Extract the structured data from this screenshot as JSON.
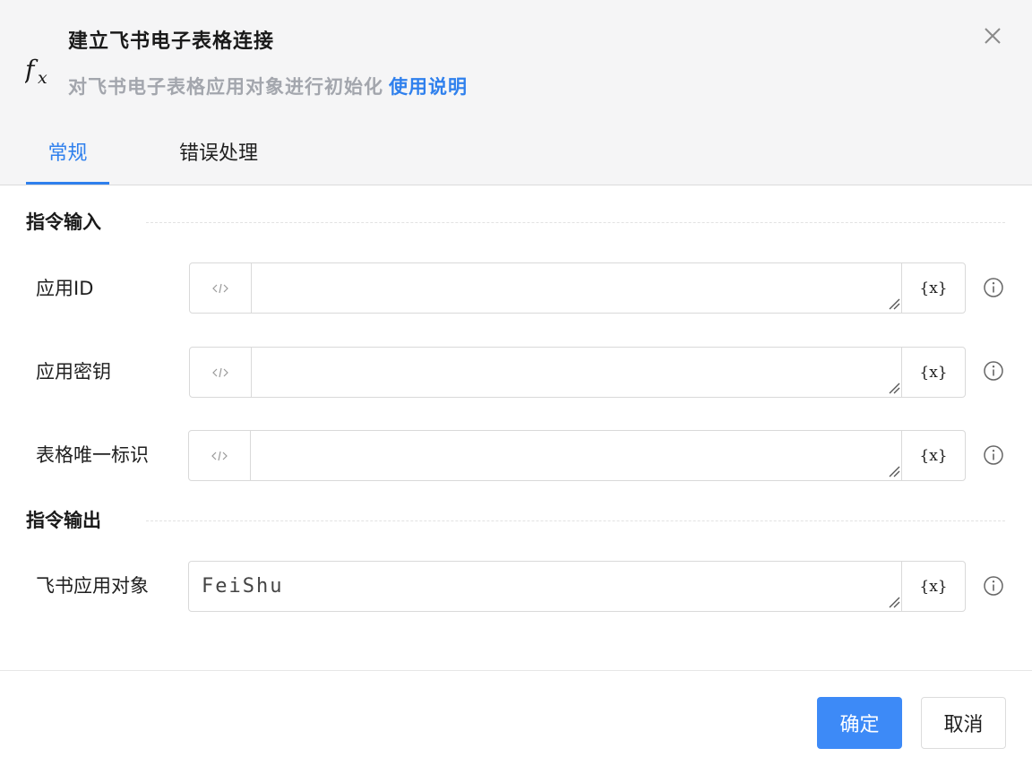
{
  "dialog": {
    "title": "建立飞书电子表格连接",
    "subtitle": "对飞书电子表格应用对象进行初始化",
    "help_link": "使用说明",
    "icon": "fx-icon"
  },
  "tabs": [
    {
      "label": "常规",
      "active": true
    },
    {
      "label": "错误处理",
      "active": false
    }
  ],
  "sections": {
    "input_title": "指令输入",
    "output_title": "指令输出"
  },
  "fields": [
    {
      "label": "应用ID",
      "value": ""
    },
    {
      "label": "应用密钥",
      "value": ""
    },
    {
      "label": "表格唯一标识",
      "value": ""
    }
  ],
  "output_field": {
    "label": "飞书应用对象",
    "value": "FeiShu"
  },
  "var_button": "{x}",
  "buttons": {
    "ok": "确定",
    "cancel": "取消"
  },
  "colors": {
    "accent": "#2f80ed",
    "primary_button": "#3d8af7",
    "header_bg": "#f5f5f6"
  }
}
